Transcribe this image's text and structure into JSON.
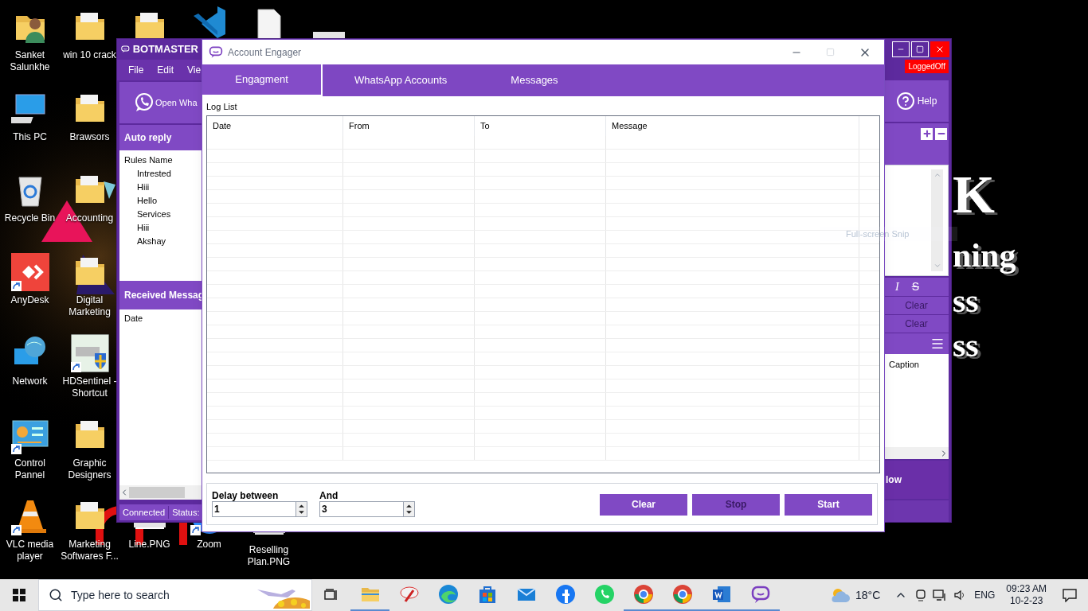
{
  "desktop": {
    "icons": [
      {
        "label": "Sanket Salunkhe",
        "kind": "user",
        "shortcut": false
      },
      {
        "label": "win 10 crack",
        "kind": "folder",
        "shortcut": false
      },
      {
        "kind": "folder",
        "shortcut": false
      },
      {
        "kind": "code",
        "shortcut": false
      },
      {
        "kind": "document",
        "shortcut": false
      },
      {
        "kind": "image",
        "shortcut": false
      },
      {
        "label": "This PC",
        "kind": "pc",
        "shortcut": false
      },
      {
        "label": "Brawsors",
        "kind": "folder",
        "shortcut": false
      },
      {
        "label": "Recycle Bin",
        "kind": "recycle",
        "shortcut": false
      },
      {
        "label": "Accounting",
        "kind": "folder",
        "shortcut": false
      },
      {
        "label": "AnyDesk",
        "kind": "remote",
        "shortcut": true
      },
      {
        "label": "Digital Marketing",
        "kind": "folder",
        "shortcut": false
      },
      {
        "label": "Network",
        "kind": "network",
        "shortcut": false
      },
      {
        "label": "HDSentinel - Shortcut",
        "kind": "drive",
        "shortcut": true
      },
      {
        "label": "Control Pannel",
        "kind": "panel",
        "shortcut": true
      },
      {
        "label": "Graphic Designers",
        "kind": "folder",
        "shortcut": false
      },
      {
        "label": "VLC media player",
        "kind": "cone",
        "shortcut": true
      },
      {
        "label": "Marketing Softwares F...",
        "kind": "folder",
        "shortcut": false
      },
      {
        "label": "Line.PNG",
        "kind": "image",
        "shortcut": false
      },
      {
        "label": "Zoom",
        "kind": "video",
        "shortcut": true
      },
      {
        "label": "Reselling Plan.PNG",
        "kind": "image",
        "shortcut": false
      }
    ],
    "wallpaper_text": [
      "K",
      "ning",
      "ss",
      "ss"
    ],
    "tooltip": "Full-screen Snip"
  },
  "botmaster": {
    "title": "BOTMASTER",
    "menu": [
      "File",
      "Edit",
      "Vie"
    ],
    "open_button": "Open Wha",
    "auto_reply": {
      "title": "Auto reply",
      "header": "Rules Name",
      "rules": [
        "Intrested",
        "Hiii",
        "Hello",
        "Services",
        "Hiii",
        "Akshay"
      ]
    },
    "received": {
      "title": "Received Messag",
      "header": "Date"
    },
    "status": [
      "Connected",
      "Status:"
    ],
    "login_badge": "LoggedOff",
    "help": "Help",
    "format_buttons": [
      {
        "label": "I",
        "kind": "italic"
      },
      {
        "label": "S",
        "kind": "strike"
      }
    ],
    "clear_buttons": [
      {
        "label": "Clear",
        "disabled": true
      },
      {
        "label": "Clear",
        "disabled": true
      }
    ],
    "caption_header": "Caption",
    "bottom_button": "low"
  },
  "engager": {
    "title": "Account Engager",
    "tabs": [
      {
        "label": "Engagment",
        "selected": true
      },
      {
        "label": "WhatsApp Accounts",
        "selected": false
      },
      {
        "label": "Messages",
        "selected": false
      }
    ],
    "log_label": "Log List",
    "columns": [
      "Date",
      "From",
      "To",
      "Message"
    ],
    "delay_label": "Delay between",
    "delay_from": "1",
    "and_label": "And",
    "delay_to": "3",
    "buttons": [
      {
        "label": "Clear",
        "disabled": false
      },
      {
        "label": "Stop",
        "disabled": true
      },
      {
        "label": "Start",
        "disabled": false
      }
    ]
  },
  "taskbar": {
    "search_placeholder": "Type here to search",
    "apps": [
      {
        "kind": "folder",
        "running": true
      },
      {
        "kind": "pen",
        "running": false
      },
      {
        "kind": "edge",
        "running": false
      },
      {
        "kind": "store",
        "running": false
      },
      {
        "kind": "mail",
        "running": false
      },
      {
        "kind": "social",
        "running": false
      },
      {
        "kind": "phone",
        "running": false
      },
      {
        "kind": "chrome",
        "running": true
      },
      {
        "kind": "chrome",
        "running": true
      },
      {
        "kind": "word",
        "running": true
      },
      {
        "kind": "chat",
        "running": true
      }
    ],
    "temperature": "18°C",
    "language": "ENG",
    "time": "09:23 AM",
    "date": "10-2-23"
  }
}
